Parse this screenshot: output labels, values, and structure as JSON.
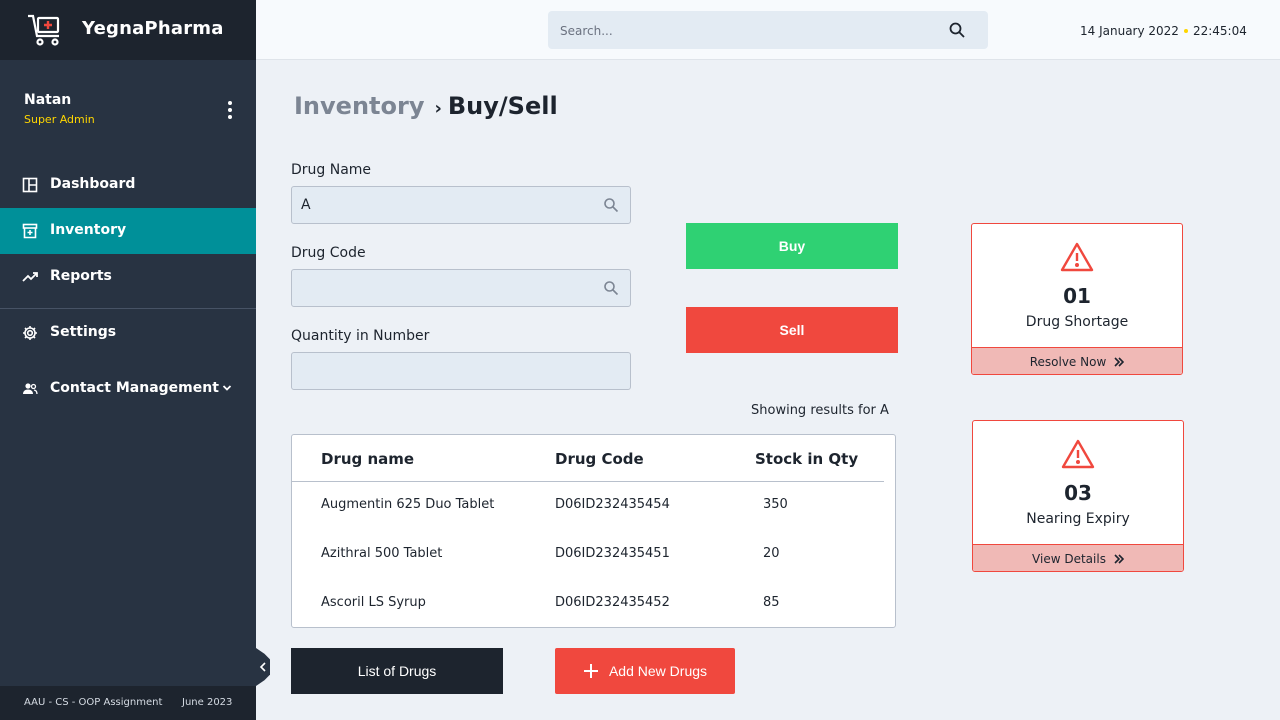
{
  "brand": {
    "name": "YegnaPharma",
    "logo_icon": "pharmacy-cart-icon"
  },
  "user": {
    "name": "Natan",
    "role": "Super Admin"
  },
  "nav": {
    "items": [
      {
        "label": "Dashboard",
        "icon": "dashboard-icon"
      },
      {
        "label": "Inventory",
        "icon": "inventory-icon",
        "active": true
      },
      {
        "label": "Reports",
        "icon": "reports-icon"
      },
      {
        "label": "Settings",
        "icon": "gear-icon"
      },
      {
        "label": "Contact Management",
        "icon": "users-icon"
      }
    ]
  },
  "footer": {
    "left": "AAU - CS - OOP Assignment",
    "right": "June 2023"
  },
  "topbar": {
    "search_placeholder": "Search...",
    "date": "14 January 2022",
    "time": "22:45:04"
  },
  "breadcrumb": {
    "parent": "Inventory",
    "current": "Buy/Sell"
  },
  "form": {
    "drug_name_label": "Drug Name",
    "drug_name_value": "A",
    "drug_code_label": "Drug Code",
    "drug_code_value": "",
    "quantity_label": "Quantity in Number",
    "quantity_value": ""
  },
  "actions": {
    "buy": "Buy",
    "sell": "Sell",
    "list": "List of Drugs",
    "add": "Add New Drugs"
  },
  "alerts": [
    {
      "count": "01",
      "title": "Drug Shortage",
      "action": "Resolve Now"
    },
    {
      "count": "03",
      "title": "Nearing Expiry",
      "action": "View Details"
    }
  ],
  "results_note": "Showing results for A",
  "table": {
    "headers": [
      "Drug name",
      "Drug Code",
      "Stock in Qty"
    ],
    "rows": [
      [
        "Augmentin 625 Duo Tablet",
        "D06ID232435454",
        "350"
      ],
      [
        "Azithral 500 Tablet",
        "D06ID232435451",
        "20"
      ],
      [
        "Ascoril LS Syrup",
        "D06ID232435452",
        "85"
      ]
    ]
  },
  "colors": {
    "accent": "#009099",
    "buy": "#2fd173",
    "sell": "#f0483e",
    "warning": "#f0483e",
    "sidebar": "#283342"
  }
}
